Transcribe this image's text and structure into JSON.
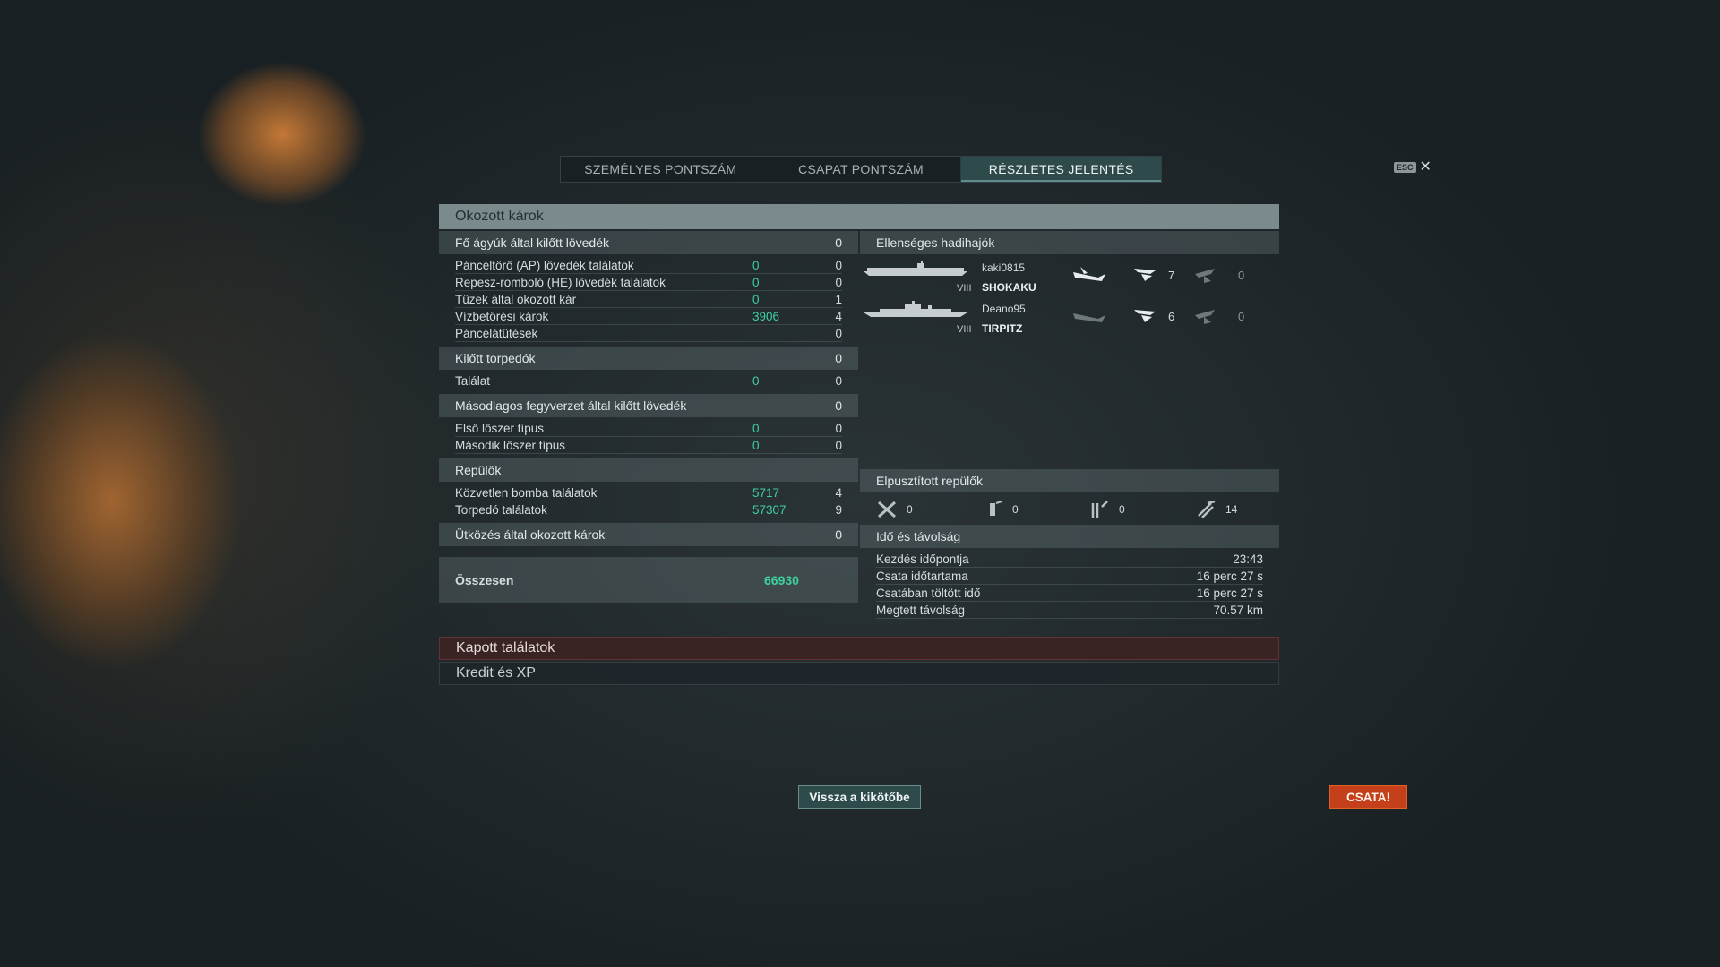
{
  "tabs": [
    {
      "label": "SZEMÉLYES PONTSZÁM",
      "active": false
    },
    {
      "label": "CSAPAT PONTSZÁM",
      "active": false
    },
    {
      "label": "RÉSZLETES JELENTÉS",
      "active": true
    }
  ],
  "esc": {
    "key": "ESC",
    "close": "✕"
  },
  "panel_title": "Okozott károk",
  "damage": {
    "main_guns": {
      "label": "Fő ágyúk által kilőtt lövedék",
      "value": "0",
      "rows": [
        {
          "label": "Páncéltörő (AP) lövedék találatok",
          "damage": "0",
          "count": "0"
        },
        {
          "label": "Repesz-romboló (HE) lövedék találatok",
          "damage": "0",
          "count": "0"
        },
        {
          "label": "Tüzek által okozott kár",
          "damage": "0",
          "count": "1"
        },
        {
          "label": "Vízbetörési károk",
          "damage": "3906",
          "count": "4"
        },
        {
          "label": "Páncélátütések",
          "damage": "",
          "count": "0"
        }
      ]
    },
    "torpedoes": {
      "label": "Kilőtt torpedók",
      "value": "0",
      "rows": [
        {
          "label": "Találat",
          "damage": "0",
          "count": "0"
        }
      ]
    },
    "secondary": {
      "label": "Másodlagos fegyverzet által kilőtt lövedék",
      "value": "0",
      "rows": [
        {
          "label": "Első lőszer típus",
          "damage": "0",
          "count": "0"
        },
        {
          "label": "Második lőszer típus",
          "damage": "0",
          "count": "0"
        }
      ]
    },
    "aircraft": {
      "label": "Repülők",
      "value": "",
      "rows": [
        {
          "label": "Közvetlen bomba találatok",
          "damage": "5717",
          "count": "4"
        },
        {
          "label": "Torpedó találatok",
          "damage": "57307",
          "count": "9"
        }
      ]
    },
    "ramming": {
      "label": "Ütközés által okozott károk",
      "value": "0"
    },
    "total": {
      "label": "Összesen",
      "value": "66930"
    }
  },
  "enemies": {
    "label": "Ellenséges hadihajók",
    "list": [
      {
        "player": "kaki0815",
        "tier": "VIII",
        "ship": "SHOKAKU",
        "c1": "7",
        "c2": "0"
      },
      {
        "player": "Deano95",
        "tier": "VIII",
        "ship": "TIRPITZ",
        "c1": "6",
        "c2": "0"
      }
    ]
  },
  "planes_destroyed": {
    "label": "Elpusztított repülők",
    "counts": [
      "0",
      "0",
      "0",
      "14"
    ]
  },
  "time": {
    "label": "Idő és távolság",
    "rows": [
      {
        "label": "Kezdés időpontja",
        "value": "23:43"
      },
      {
        "label": "Csata időtartama",
        "value": "16 perc 27 s"
      },
      {
        "label": "Csatában töltött idő",
        "value": "16 perc 27 s"
      },
      {
        "label": "Megtett távolság",
        "value": "70.57 km"
      }
    ]
  },
  "sections": {
    "received": "Kapott találatok",
    "credits": "Kredit és XP"
  },
  "buttons": {
    "back": "Vissza a kikötőbe",
    "battle": "CSATA!"
  },
  "colors": {
    "accent": "#3fd0a0",
    "battle": "#c5401a",
    "tab_active": "#2f4a4b"
  }
}
